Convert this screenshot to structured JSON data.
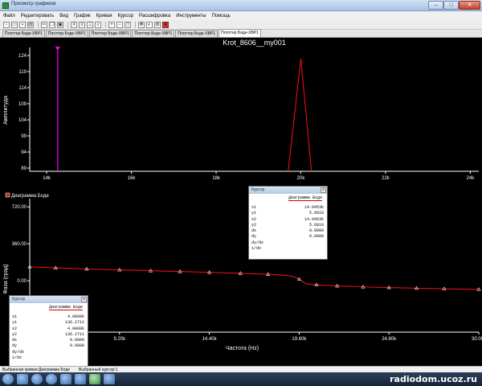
{
  "window": {
    "title": "Просмотр графиков",
    "min_glyph": "–",
    "max_glyph": "□",
    "close_glyph": "✕"
  },
  "menu": [
    "Файл",
    "Редактировать",
    "Вид",
    "График",
    "Кривая",
    "Курсор",
    "Расшифровка",
    "Инструменты",
    "Помощь"
  ],
  "toolbar_icons": [
    "new-icon",
    "open-icon",
    "save-icon",
    "print-icon",
    "separator",
    "cut-icon",
    "copy-icon",
    "paste-icon",
    "separator",
    "grid-icon",
    "legend-icon",
    "cursor-icon",
    "zoom-icon",
    "separator",
    "zoom-in-icon",
    "zoom-out-icon",
    "zoom-fit-icon",
    "separator",
    "pan-icon",
    "reverse-colors-icon",
    "properties-icon",
    "stop-icon"
  ],
  "tabs": [
    {
      "label": "Плоттер Боде-XBP1",
      "active": false
    },
    {
      "label": "Плоттер Боде-XBP1",
      "active": false
    },
    {
      "label": "Плоттер Боде-XBP1",
      "active": false
    },
    {
      "label": "Плоттер Боде-XBP1",
      "active": false
    },
    {
      "label": "Плоттер Боде-XBP1",
      "active": false
    },
    {
      "label": "Плоттер Боде-XBP1",
      "active": true
    }
  ],
  "chart_data": [
    {
      "type": "line",
      "title": "Krot_8606__my001",
      "ylabel": "Амплитуда",
      "xlabel": "",
      "x_ticks": [
        "14k",
        "16k",
        "18k",
        "20k",
        "22k",
        "24k"
      ],
      "x_tick_values": [
        14000,
        16000,
        18000,
        20000,
        22000,
        24000
      ],
      "y_ticks": [
        "89",
        "94",
        "99",
        "104",
        "109",
        "114",
        "119",
        "124"
      ],
      "y_tick_values": [
        89,
        94,
        99,
        104,
        109,
        114,
        119,
        124
      ],
      "xlim": [
        13600,
        24200
      ],
      "ylim": [
        88,
        126.5
      ],
      "grid": false,
      "series": [
        {
          "color": "#ff1010",
          "x": [
            19700,
            20000,
            20250
          ],
          "y": [
            88,
            123,
            88
          ]
        }
      ],
      "cursor_lines": [
        {
          "x": 14260,
          "color": "#ff00ff"
        }
      ]
    },
    {
      "type": "line",
      "title": "",
      "legend": "Диаграмма Боде",
      "legend_position": "top-left",
      "ylabel": "Фаза (град)",
      "xlabel": "Частота (Hz)",
      "x_ticks": [
        "9.20k",
        "14.40k",
        "19.60k",
        "24.80k",
        "30.00k"
      ],
      "x_tick_values": [
        9200,
        14400,
        19600,
        24800,
        30000
      ],
      "y_ticks": [
        "720.00",
        "360.00",
        "0.00"
      ],
      "y_tick_values": [
        720,
        360,
        0
      ],
      "xlim": [
        4000,
        30000
      ],
      "ylim": [
        -500,
        800
      ],
      "grid": false,
      "series": [
        {
          "color": "#ff1010",
          "x": [
            4000,
            5500,
            7300,
            9200,
            11000,
            12700,
            14400,
            16200,
            17800,
            18800,
            19300,
            19600,
            20000,
            20600,
            21800,
            23300,
            24800,
            26400,
            28000,
            30000
          ],
          "y": [
            136.27,
            126,
            115,
            106,
            98,
            90,
            82,
            73,
            63,
            54,
            40,
            15,
            -30,
            -40,
            -50,
            -59,
            -66,
            -72,
            -78,
            -84
          ]
        }
      ],
      "markers_x": [
        4000,
        5500,
        7300,
        9200,
        11000,
        12700,
        14400,
        16200,
        17800,
        19600,
        20600,
        21800,
        23300,
        24800,
        26400,
        28000,
        30000
      ]
    }
  ],
  "cursor_boxes": [
    {
      "title": "Курсор",
      "heading": "Диаграмма Боде",
      "rows": [
        {
          "k": "x1",
          "v": "14.0453k"
        },
        {
          "k": "y1",
          "v": "5.6818"
        },
        {
          "k": "x2",
          "v": "14.0453k"
        },
        {
          "k": "y2",
          "v": "5.6818"
        },
        {
          "k": "dx",
          "v": "0.0000"
        },
        {
          "k": "dy",
          "v": "0.0000"
        },
        {
          "k": "dy/dx",
          "v": ""
        },
        {
          "k": "1/dx",
          "v": ""
        }
      ]
    },
    {
      "title": "Курсор",
      "heading": "Диаграмма Боде",
      "rows": [
        {
          "k": "x1",
          "v": "4.0000k"
        },
        {
          "k": "y1",
          "v": "136.2711"
        },
        {
          "k": "x2",
          "v": "4.0000k"
        },
        {
          "k": "y2",
          "v": "136.2711"
        },
        {
          "k": "dx",
          "v": "0.0000"
        },
        {
          "k": "dy",
          "v": "0.0000"
        },
        {
          "k": "dy/dx",
          "v": ""
        },
        {
          "k": "1/dx",
          "v": ""
        }
      ]
    }
  ],
  "status": {
    "left": "Выбранная кривая:Диаграмма Боде",
    "right": "Выбранный курсор:1"
  },
  "watermark": "radiodom.ucoz.ru",
  "colors": {
    "background": "#000000",
    "trace": "#ff1010",
    "cursor_magenta": "#ff00ff",
    "axis": "#ffffff",
    "heading_underline": "#dd0000"
  }
}
